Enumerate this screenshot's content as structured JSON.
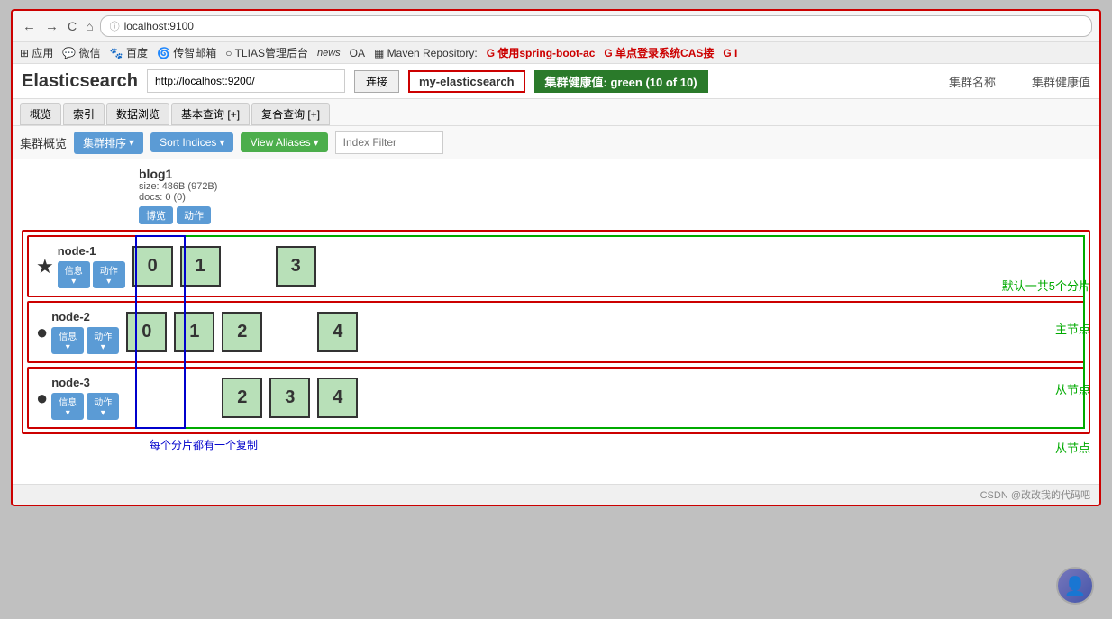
{
  "browser": {
    "url": "localhost:9100",
    "back_btn": "←",
    "forward_btn": "→",
    "refresh_btn": "C",
    "home_btn": "⌂",
    "address_icon": "ⓘ",
    "address_full": "localhost:9100"
  },
  "bookmarks": [
    {
      "label": "应用"
    },
    {
      "label": "微信",
      "icon": "💬"
    },
    {
      "label": "百度",
      "icon": "🐾"
    },
    {
      "label": "传智邮箱",
      "icon": "📧"
    },
    {
      "label": "TLIAS管理后台"
    },
    {
      "label": "OA"
    },
    {
      "label": "Maven Repository:"
    },
    {
      "label": "使用spring-boot-ac",
      "icon": "G"
    },
    {
      "label": "单点登录系统CAS接",
      "icon": "G"
    }
  ],
  "app": {
    "title": "Elasticsearch",
    "url_value": "http://localhost:9200/",
    "connect_label": "连接",
    "cluster_name": "my-elasticsearch",
    "cluster_health": "集群健康值: green (10 of 10)",
    "cluster_name_label": "集群名称",
    "cluster_health_label": "集群健康值"
  },
  "nav_tabs": [
    {
      "label": "概览",
      "active": false
    },
    {
      "label": "索引",
      "active": false
    },
    {
      "label": "数据浏览",
      "active": false
    },
    {
      "label": "基本查询 [+]",
      "active": false
    },
    {
      "label": "复合查询 [+]",
      "active": false
    }
  ],
  "toolbar": {
    "section_label": "集群概览",
    "cluster_sort_label": "集群排序",
    "sort_indices_label": "Sort Indices",
    "view_aliases_label": "View Aliases",
    "index_filter_placeholder": "Index Filter",
    "dropdown_arrow": "▾"
  },
  "index": {
    "name": "blog1",
    "size": "size: 486B (972B)",
    "docs": "docs: 0 (0)",
    "btn1": "博览",
    "btn2": "动作"
  },
  "annotations": {
    "default_shards": "默认一共5个分片",
    "master_node": "主节点",
    "replica_node1": "从节点",
    "replica_node2": "从节点",
    "each_replica": "每个分片都有一个复制"
  },
  "nodes": [
    {
      "name": "node-1",
      "icon": "★",
      "is_master": true,
      "info_label": "信息",
      "action_label": "动作",
      "shards": [
        {
          "num": "0",
          "present": true
        },
        {
          "num": "1",
          "present": true
        },
        {
          "num": "2",
          "present": false
        },
        {
          "num": "3",
          "present": true
        },
        {
          "num": "4",
          "present": false
        }
      ]
    },
    {
      "name": "node-2",
      "icon": "●",
      "is_master": false,
      "info_label": "信息",
      "action_label": "动作",
      "shards": [
        {
          "num": "0",
          "present": true
        },
        {
          "num": "1",
          "present": true
        },
        {
          "num": "2",
          "present": true
        },
        {
          "num": "3",
          "present": false
        },
        {
          "num": "4",
          "present": true
        }
      ]
    },
    {
      "name": "node-3",
      "icon": "●",
      "is_master": false,
      "info_label": "信息",
      "action_label": "动作",
      "shards": [
        {
          "num": "0",
          "present": false
        },
        {
          "num": "1",
          "present": false
        },
        {
          "num": "2",
          "present": true
        },
        {
          "num": "3",
          "present": true
        },
        {
          "num": "4",
          "present": true
        }
      ]
    }
  ],
  "csdn": {
    "watermark": "CSDN @改改我的代码吧"
  }
}
